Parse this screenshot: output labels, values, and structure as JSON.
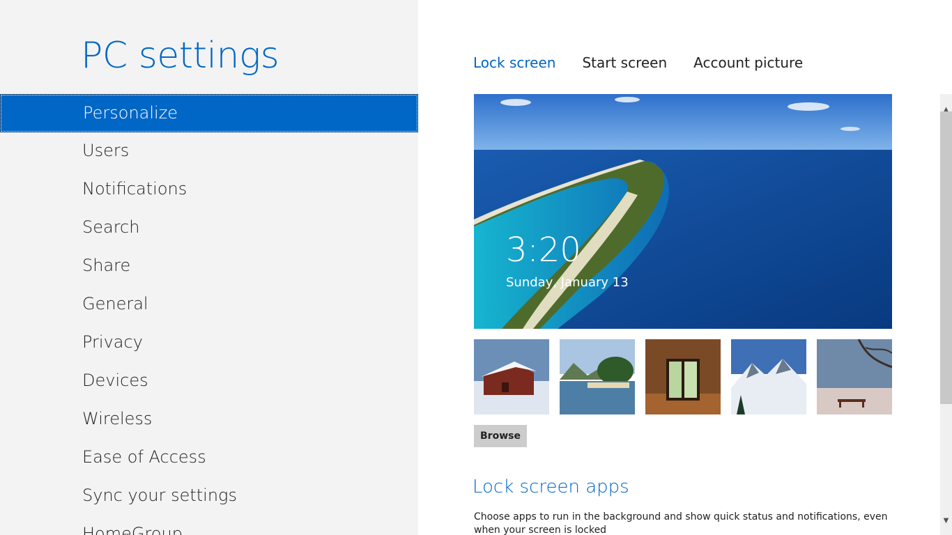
{
  "app": {
    "title": "PC settings"
  },
  "nav": {
    "items": [
      {
        "label": "Personalize",
        "selected": true
      },
      {
        "label": "Users"
      },
      {
        "label": "Notifications"
      },
      {
        "label": "Search"
      },
      {
        "label": "Share"
      },
      {
        "label": "General"
      },
      {
        "label": "Privacy"
      },
      {
        "label": "Devices"
      },
      {
        "label": "Wireless"
      },
      {
        "label": "Ease of Access"
      },
      {
        "label": "Sync your settings"
      },
      {
        "label": "HomeGroup"
      }
    ]
  },
  "tabs": [
    {
      "label": "Lock screen",
      "active": true
    },
    {
      "label": "Start screen"
    },
    {
      "label": "Account picture"
    }
  ],
  "preview": {
    "time": "3:20",
    "date": "Sunday, January 13"
  },
  "thumbnails": [
    {
      "name": "snow-barn"
    },
    {
      "name": "lake-island"
    },
    {
      "name": "room-window"
    },
    {
      "name": "snowy-mountains"
    },
    {
      "name": "winter-bench"
    }
  ],
  "browse": {
    "label": "Browse"
  },
  "lock_apps": {
    "title": "Lock screen apps",
    "description": "Choose apps to run in the background and show quick status and notifications, even when your screen is locked"
  },
  "icons": {
    "scroll_up": "chevron-up-icon",
    "scroll_down": "chevron-down-icon"
  },
  "colors": {
    "accent": "#0066c4",
    "selected_bg": "#0067c6",
    "left_bg": "#f3f3f3"
  }
}
